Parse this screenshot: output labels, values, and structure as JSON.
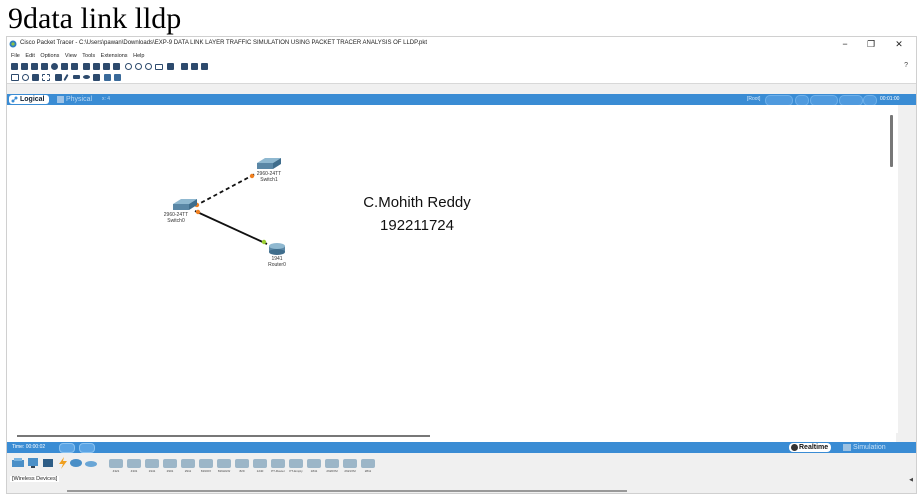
{
  "heading": "9data link lldp",
  "window": {
    "title": "Cisco Packet Tracer - C:\\Users\\pawan\\Downloads\\EXP-9 DATA LINK LAYER TRAFFIC SIMULATION USING PACKET TRACER ANALYSIS OF LLDP.pkt",
    "minimize": "−",
    "maximize": "❐",
    "close": "✕"
  },
  "menu": [
    "File",
    "Edit",
    "Options",
    "View",
    "Tools",
    "Extensions",
    "Help"
  ],
  "toolbar": {
    "help": "?"
  },
  "tabs": {
    "logical": "Logical",
    "physical": "Physical",
    "physical_extra": "x: 4",
    "root": "[Root]",
    "clock": "00:01:00"
  },
  "topology": {
    "switch1": {
      "model": "2960-24TT",
      "name": "Switch1"
    },
    "switch0": {
      "model": "2960-24TT",
      "name": "Switch0"
    },
    "router0": {
      "model": "1941",
      "name": "Router0"
    }
  },
  "annotation": {
    "name": "C.Mohith Reddy",
    "id": "192211724"
  },
  "status": {
    "time": "Time: 00:00:02",
    "realtime": "Realtime",
    "simulation": "Simulation"
  },
  "device_panel": {
    "category": "[Wireless Devices]",
    "models": [
      "4321",
      "4331",
      "1941",
      "2901",
      "2911",
      "819IOX",
      "819HGW",
      "829",
      "1240",
      "PT-Router",
      "PT-Empty",
      "1841",
      "2620XM",
      "2621XM",
      "2811"
    ]
  },
  "colors": {
    "accent": "#3a8cd4",
    "link_dashed": "#000000",
    "link_solid": "#000000",
    "port_up": "#9acd32",
    "port_orange": "#f08020"
  },
  "icons": [
    "cisco-app-icon",
    "logical-icon",
    "physical-icon",
    "realtime-icon",
    "simulation-icon",
    "switch-icon",
    "router-icon"
  ]
}
